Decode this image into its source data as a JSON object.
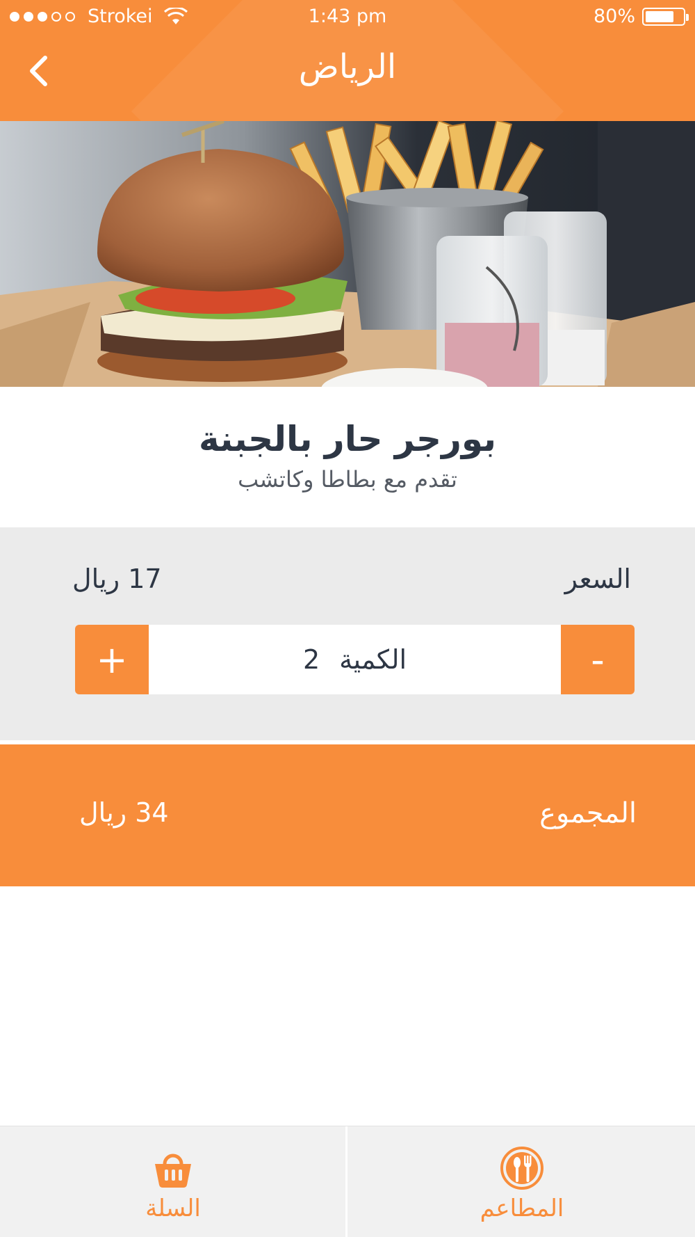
{
  "status_bar": {
    "carrier": "Strokei",
    "time": "1:43 pm",
    "battery": "80%",
    "battery_level": 0.8,
    "signal_bars": 3,
    "signal_total": 5
  },
  "nav": {
    "title": "الرياض",
    "back_icon": "chevron-left-icon"
  },
  "hero": {
    "subject": "burger-and-fries-photo"
  },
  "item": {
    "title": "بورجر حار بالجبنة",
    "subtitle": "تقدم مع بطاطا وكاتشب"
  },
  "price": {
    "label": "السعر",
    "value": "17 ريال"
  },
  "quantity": {
    "label": "الكمية",
    "value": "2",
    "plus_label": "+",
    "minus_label": "-"
  },
  "total": {
    "label": "المجموع",
    "value": "34 ريال"
  },
  "tabs": [
    {
      "label": "السلة",
      "icon": "basket-icon"
    },
    {
      "label": "المطاعم",
      "icon": "restaurant-icon"
    }
  ],
  "colors": {
    "accent": "#f88d3b",
    "text_dark": "#2d3644",
    "section_gray": "#ebebeb",
    "tab_gray": "#f1f1f1"
  }
}
